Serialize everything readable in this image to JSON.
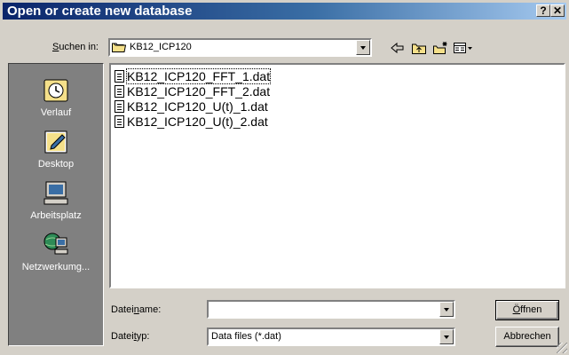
{
  "window": {
    "title": "Open or create new database",
    "help_glyph": "?",
    "close_glyph": "✕"
  },
  "look_in": {
    "label_pre": "",
    "label_key": "S",
    "label_post": "uchen in:",
    "value": "KB12_ICP120"
  },
  "toolbar": {
    "back_icon": "back-arrow-icon",
    "up_icon": "up-folder-icon",
    "new_folder_icon": "new-folder-icon",
    "view_menu_icon": "view-menu-icon"
  },
  "places": [
    {
      "label": "Verlauf",
      "icon": "history-icon"
    },
    {
      "label": "Desktop",
      "icon": "desktop-icon"
    },
    {
      "label": "Arbeitsplatz",
      "icon": "computer-icon"
    },
    {
      "label": "Netzwerkumg...",
      "icon": "network-icon"
    }
  ],
  "files": [
    "KB12_ICP120_FFT_1.dat",
    "KB12_ICP120_FFT_2.dat",
    "KB12_ICP120_U(t)_1.dat",
    "KB12_ICP120_U(t)_2.dat"
  ],
  "filename": {
    "label_pre": "Datei",
    "label_key": "n",
    "label_post": "ame:",
    "value": ""
  },
  "filetype": {
    "label_pre": "Datei",
    "label_key": "t",
    "label_post": "yp:",
    "value": "Data files (*.dat)"
  },
  "buttons": {
    "open_key": "Ö",
    "open_rest": "ffnen",
    "cancel": "Abbrechen"
  }
}
